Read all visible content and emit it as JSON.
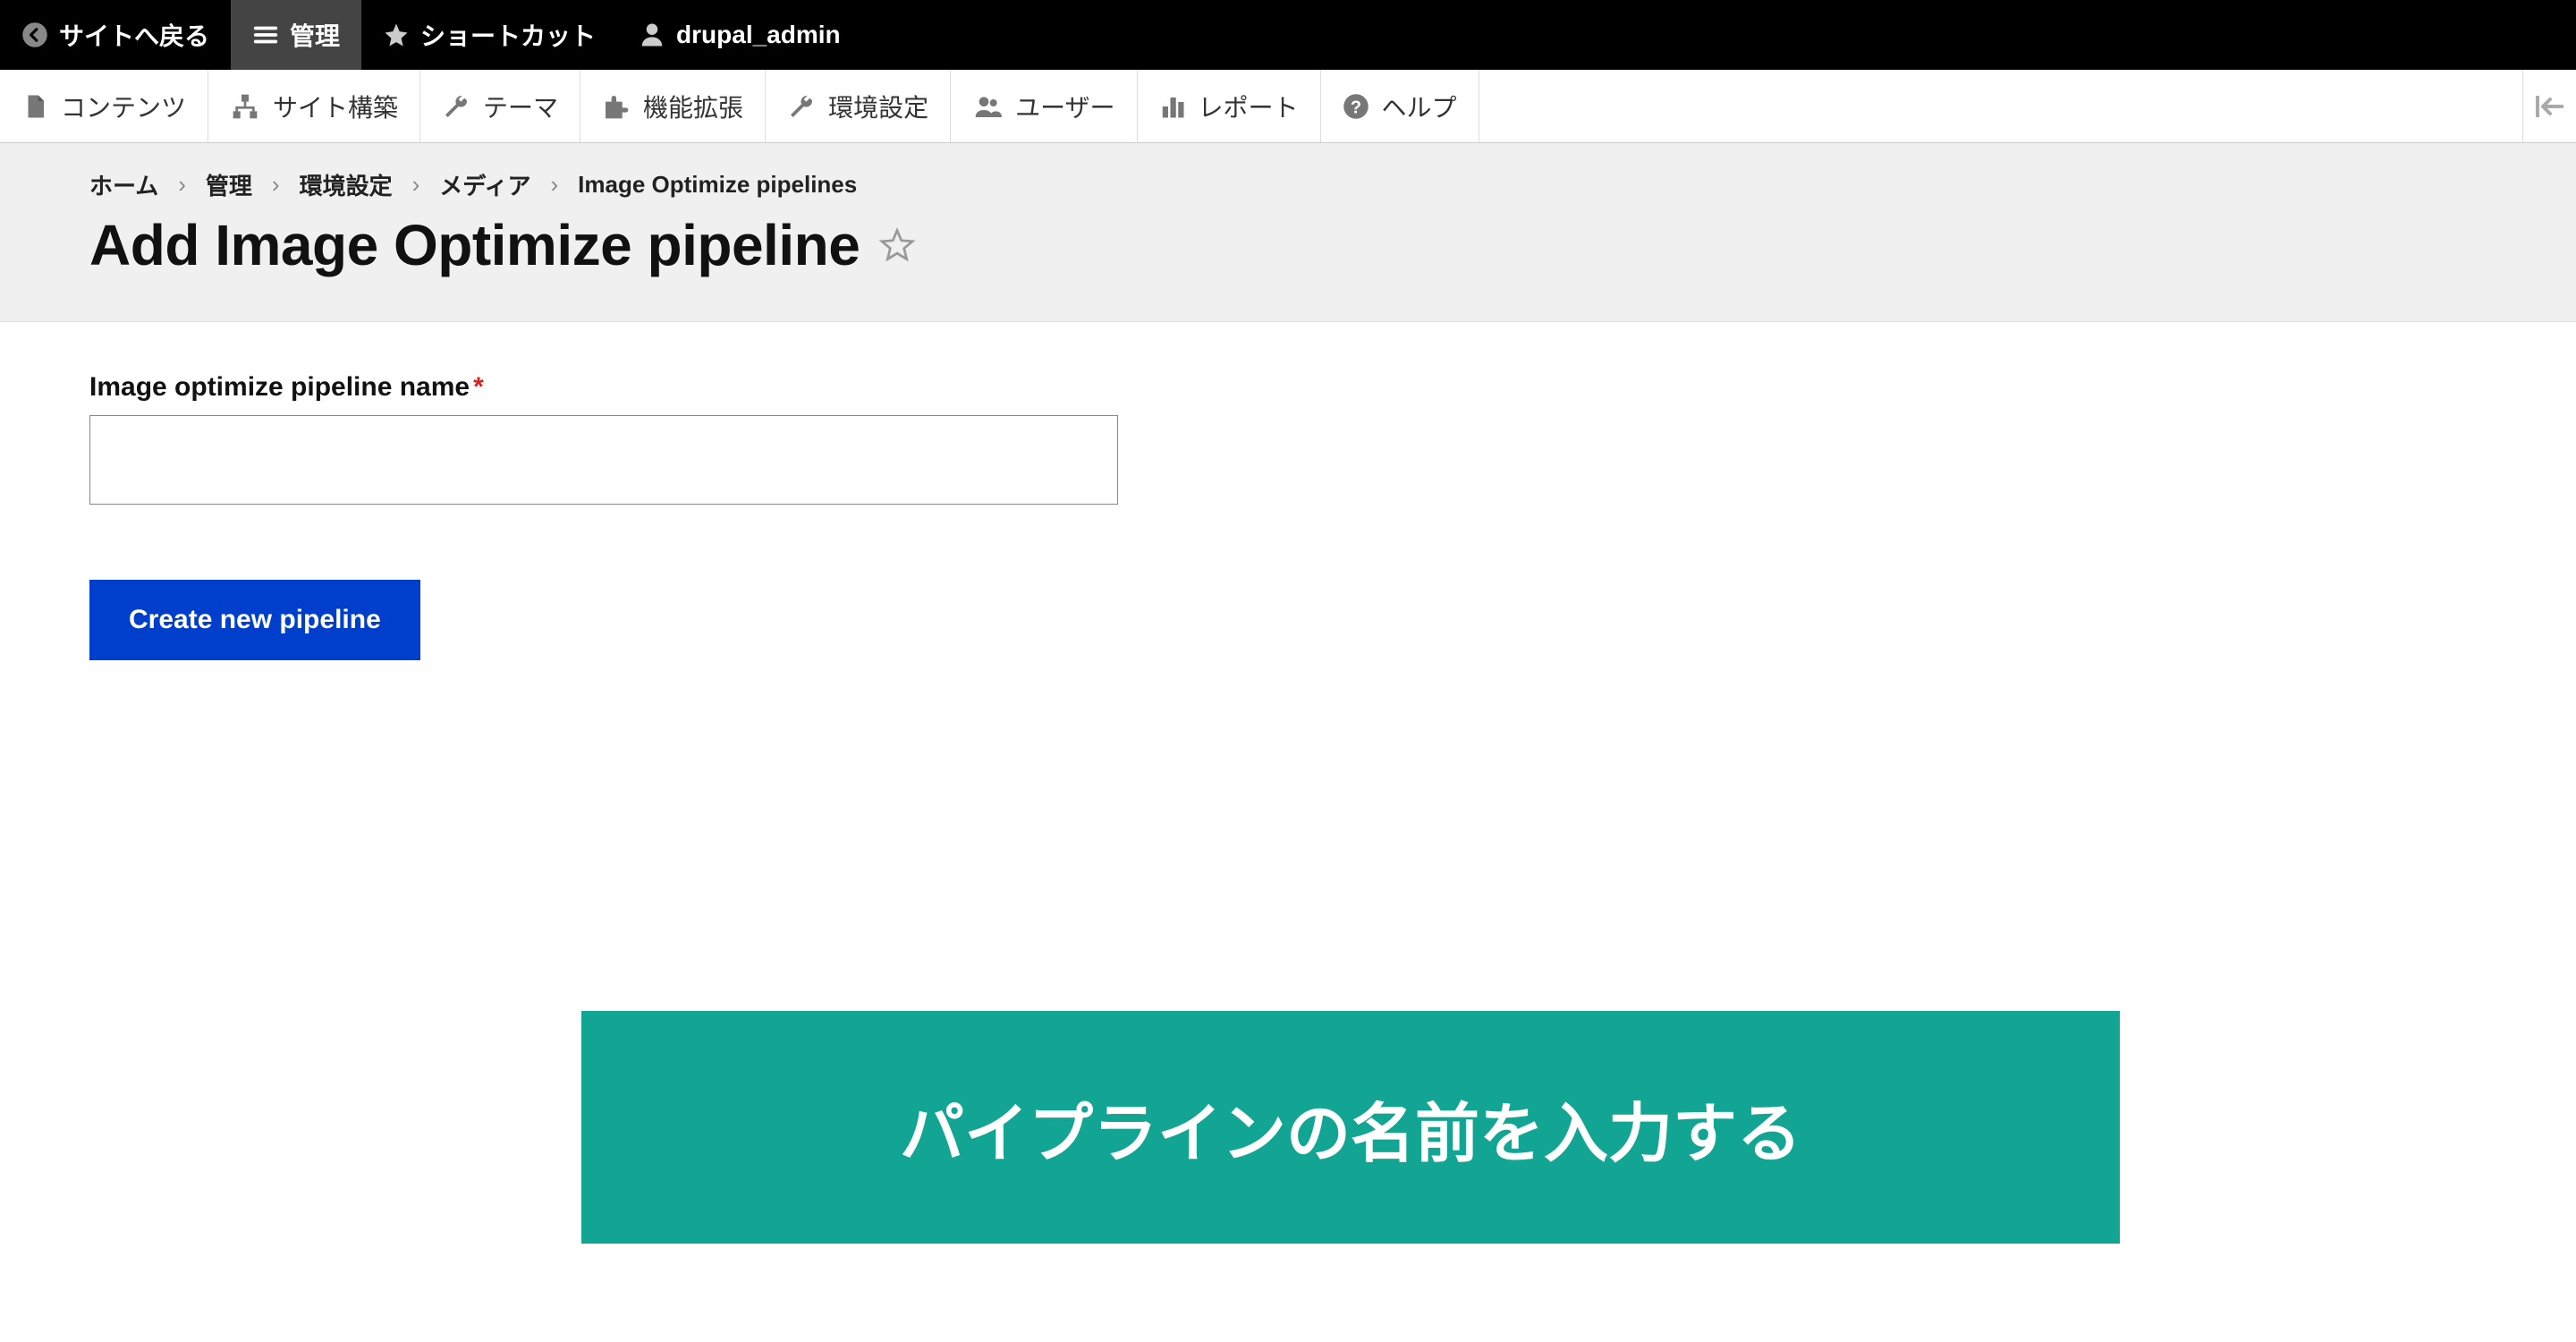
{
  "topbar": {
    "back_to_site": "サイトへ戻る",
    "manage": "管理",
    "shortcuts": "ショートカット",
    "user": "drupal_admin"
  },
  "adminbar": {
    "content": "コンテンツ",
    "structure": "サイト構築",
    "appearance": "テーマ",
    "extend": "機能拡張",
    "config": "環境設定",
    "people": "ユーザー",
    "reports": "レポート",
    "help": "ヘルプ"
  },
  "breadcrumb": {
    "home": "ホーム",
    "admin": "管理",
    "config": "環境設定",
    "media": "メディア",
    "pipelines": "Image Optimize pipelines"
  },
  "page": {
    "title": "Add Image Optimize pipeline"
  },
  "form": {
    "name_label": "Image optimize pipeline name",
    "name_value": "",
    "submit": "Create new pipeline"
  },
  "overlay": {
    "text": "パイプラインの名前を入力する"
  },
  "colors": {
    "primary_button": "#003ecc",
    "overlay_bg": "#12a594",
    "required": "#d72222"
  }
}
